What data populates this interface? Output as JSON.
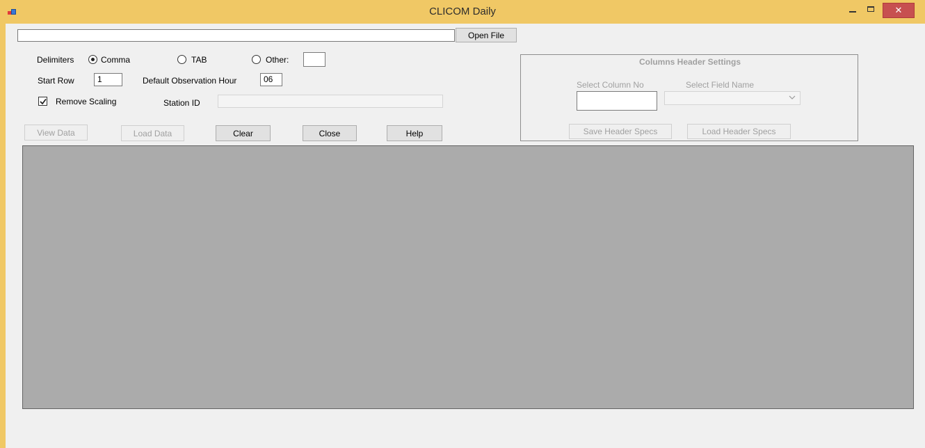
{
  "window": {
    "title": "CLICOM Daily",
    "controls": {
      "minimize": "–",
      "maximize": "□",
      "close": "✕"
    }
  },
  "file": {
    "path_value": "",
    "open_file_label": "Open File"
  },
  "delimiters": {
    "label": "Delimiters",
    "options": [
      {
        "label": "Comma",
        "selected": true
      },
      {
        "label": "TAB",
        "selected": false
      },
      {
        "label": "Other:",
        "selected": false
      }
    ],
    "other_value": ""
  },
  "start_row": {
    "label": "Start Row",
    "value": "1"
  },
  "observation_hour": {
    "label": "Default Observation Hour",
    "value": "06"
  },
  "remove_scaling": {
    "label": "Remove Scaling",
    "checked": true
  },
  "station_id": {
    "label": "Station ID",
    "value": ""
  },
  "buttons": {
    "view_data": "View Data",
    "load_data": "Load Data",
    "clear": "Clear",
    "close": "Close",
    "help": "Help"
  },
  "header_settings": {
    "title": "Columns Header Settings",
    "select_column_label": "Select Column No",
    "select_column_value": "",
    "select_field_label": "Select Field Name",
    "select_field_value": "",
    "save_label": "Save Header Specs",
    "load_label": "Load Header Specs"
  },
  "colors": {
    "titlebar": "#f0c865",
    "close_button": "#c75050",
    "client_bg": "#f0f0f0",
    "grid_bg": "#ababab"
  },
  "icons": [
    "app-icon",
    "minimize-icon",
    "maximize-icon",
    "close-icon",
    "check-icon",
    "chevron-down-icon"
  ]
}
